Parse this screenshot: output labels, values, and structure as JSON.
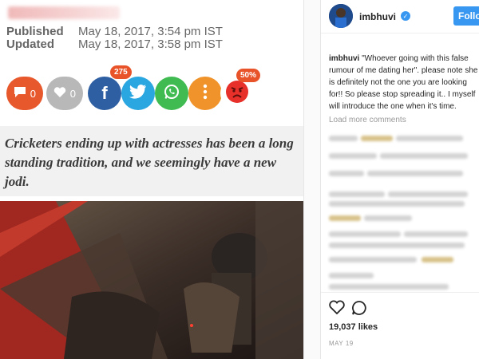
{
  "article": {
    "published_label": "Published",
    "published_value": "May 18, 2017, 3:54 pm IST",
    "updated_label": "Updated",
    "updated_value": "May 18, 2017, 3:58 pm IST",
    "share": {
      "comment_count": "0",
      "like_count": "0",
      "facebook_count": "275",
      "reaction_percent": "50%"
    },
    "quote": "Cricketers ending up with actresses has been a long standing tradition, and we seemingly have a new jodi."
  },
  "instagram": {
    "username": "imbhuvi",
    "follow_label": "Follow",
    "caption_user": "imbhuvi",
    "caption_text": " \"Whoever going with this false rumour of me dating her\". please note she is definitely not the one you are looking for!! So please stop spreading it.. I myself will introduce the one when it's time.",
    "load_more": "Load more comments",
    "likes": "19,037 likes",
    "date": "MAY 19"
  },
  "colors": {
    "comment": "#e8582d",
    "facebook": "#2f5fa3",
    "twitter": "#2aa6e0",
    "whatsapp": "#3fbb52",
    "more": "#f0932a",
    "follow": "#3897f0"
  }
}
